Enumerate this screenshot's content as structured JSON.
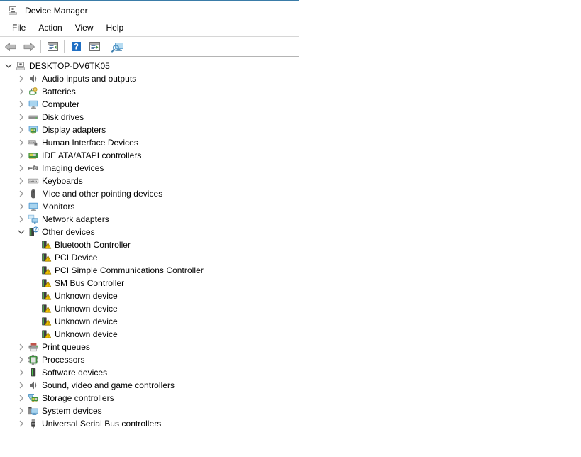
{
  "window": {
    "title": "Device Manager",
    "title_icon": "device-manager-icon",
    "accent_color": "#3a7ca8"
  },
  "menu": {
    "items": [
      {
        "label": "File",
        "name": "menu-file"
      },
      {
        "label": "Action",
        "name": "menu-action"
      },
      {
        "label": "View",
        "name": "menu-view"
      },
      {
        "label": "Help",
        "name": "menu-help"
      }
    ]
  },
  "toolbar": {
    "buttons": [
      {
        "name": "back-button",
        "icon": "back-arrow-icon",
        "tooltip": "Back"
      },
      {
        "name": "forward-button",
        "icon": "forward-arrow-icon",
        "tooltip": "Forward"
      },
      {
        "name": "properties-button",
        "icon": "properties-window-icon",
        "tooltip": "Properties"
      },
      {
        "name": "help-button",
        "icon": "help-question-icon",
        "tooltip": "Help"
      },
      {
        "name": "update-driver-button",
        "icon": "update-driver-window-icon",
        "tooltip": "Update driver"
      },
      {
        "name": "scan-hardware-button",
        "icon": "scan-hardware-monitor-icon",
        "tooltip": "Scan for hardware changes"
      }
    ]
  },
  "tree": {
    "root": {
      "label": "DESKTOP-DV6TK05",
      "icon": "computer-root-icon",
      "expanded": true,
      "level": 0
    },
    "nodes": [
      {
        "label": "Audio inputs and outputs",
        "icon": "speaker-icon",
        "expanded": false,
        "level": 1
      },
      {
        "label": "Batteries",
        "icon": "battery-icon",
        "expanded": false,
        "level": 1
      },
      {
        "label": "Computer",
        "icon": "monitor-icon",
        "expanded": false,
        "level": 1
      },
      {
        "label": "Disk drives",
        "icon": "disk-drive-icon",
        "expanded": false,
        "level": 1
      },
      {
        "label": "Display adapters",
        "icon": "display-adapter-icon",
        "expanded": false,
        "level": 1
      },
      {
        "label": "Human Interface Devices",
        "icon": "hid-icon",
        "expanded": false,
        "level": 1
      },
      {
        "label": "IDE ATA/ATAPI controllers",
        "icon": "ide-controller-icon",
        "expanded": false,
        "level": 1
      },
      {
        "label": "Imaging devices",
        "icon": "imaging-device-icon",
        "expanded": false,
        "level": 1
      },
      {
        "label": "Keyboards",
        "icon": "keyboard-icon",
        "expanded": false,
        "level": 1
      },
      {
        "label": "Mice and other pointing devices",
        "icon": "mouse-icon",
        "expanded": false,
        "level": 1
      },
      {
        "label": "Monitors",
        "icon": "monitor-icon",
        "expanded": false,
        "level": 1
      },
      {
        "label": "Network adapters",
        "icon": "network-adapter-icon",
        "expanded": false,
        "level": 1
      },
      {
        "label": "Other devices",
        "icon": "unknown-device-question-icon",
        "expanded": true,
        "level": 1
      },
      {
        "label": "Bluetooth Controller",
        "icon": "unknown-device-warning-icon",
        "expanded": null,
        "level": 2
      },
      {
        "label": "PCI Device",
        "icon": "unknown-device-warning-icon",
        "expanded": null,
        "level": 2
      },
      {
        "label": "PCI Simple Communications Controller",
        "icon": "unknown-device-warning-icon",
        "expanded": null,
        "level": 2
      },
      {
        "label": "SM Bus Controller",
        "icon": "unknown-device-warning-icon",
        "expanded": null,
        "level": 2
      },
      {
        "label": "Unknown device",
        "icon": "unknown-device-warning-icon",
        "expanded": null,
        "level": 2
      },
      {
        "label": "Unknown device",
        "icon": "unknown-device-warning-icon",
        "expanded": null,
        "level": 2
      },
      {
        "label": "Unknown device",
        "icon": "unknown-device-warning-icon",
        "expanded": null,
        "level": 2
      },
      {
        "label": "Unknown device",
        "icon": "unknown-device-warning-icon",
        "expanded": null,
        "level": 2
      },
      {
        "label": "Print queues",
        "icon": "printer-icon",
        "expanded": false,
        "level": 1
      },
      {
        "label": "Processors",
        "icon": "processor-icon",
        "expanded": false,
        "level": 1
      },
      {
        "label": "Software devices",
        "icon": "software-device-icon",
        "expanded": false,
        "level": 1
      },
      {
        "label": "Sound, video and game controllers",
        "icon": "speaker-icon",
        "expanded": false,
        "level": 1
      },
      {
        "label": "Storage controllers",
        "icon": "storage-controller-icon",
        "expanded": false,
        "level": 1
      },
      {
        "label": "System devices",
        "icon": "system-device-icon",
        "expanded": false,
        "level": 1
      },
      {
        "label": "Universal Serial Bus controllers",
        "icon": "usb-icon",
        "expanded": false,
        "level": 1
      }
    ]
  }
}
